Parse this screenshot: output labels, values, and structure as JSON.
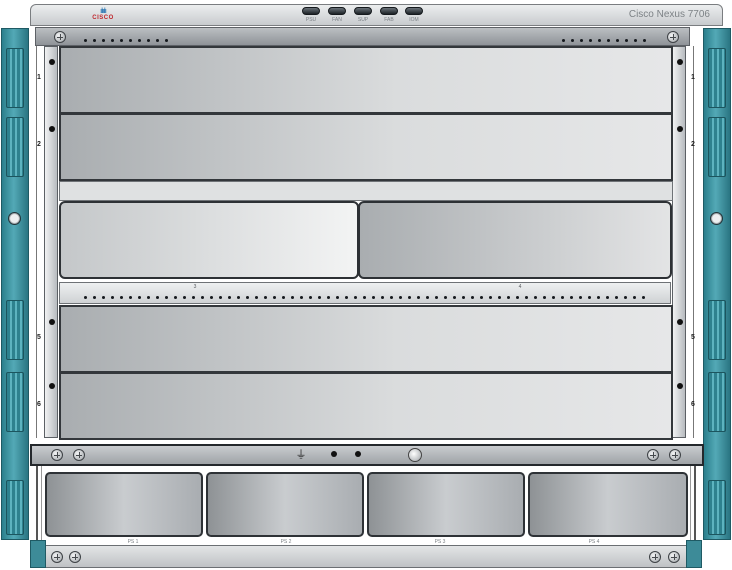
{
  "chassis": {
    "model": "Cisco Nexus 7706",
    "brand_bars": "ılıılı",
    "brand_word": "CISCO"
  },
  "status_leds": [
    {
      "label": "PSU"
    },
    {
      "label": "FAN"
    },
    {
      "label": "SUP"
    },
    {
      "label": "FAB"
    },
    {
      "label": "IOM"
    }
  ],
  "slots": {
    "left_numbers": [
      "1",
      "2",
      "5",
      "6"
    ],
    "right_numbers": [
      "1",
      "2",
      "5",
      "6"
    ],
    "supervisors": [
      {
        "label": "3"
      },
      {
        "label": "4"
      }
    ]
  },
  "power_supplies": [
    {
      "label": "PS 1"
    },
    {
      "label": "PS 2"
    },
    {
      "label": "PS 3"
    },
    {
      "label": "PS 4"
    }
  ],
  "colors": {
    "ear": "#3a8f9c",
    "cisco_blue": "#0b62a8",
    "cisco_red": "#c0272d"
  }
}
